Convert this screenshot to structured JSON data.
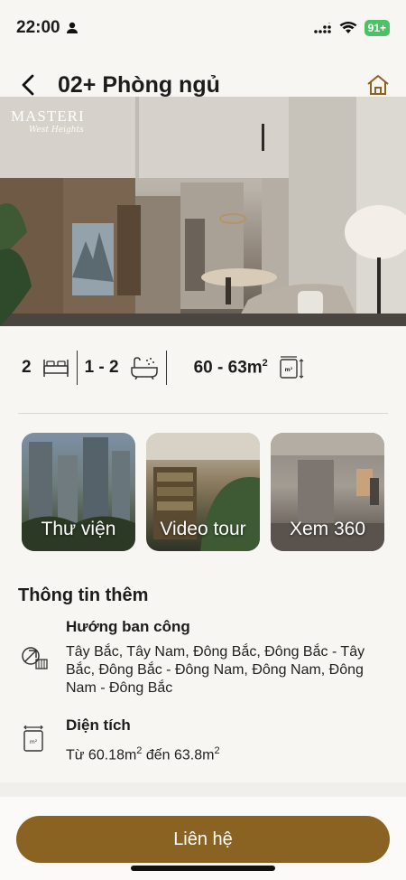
{
  "status": {
    "time": "22:00",
    "battery": "91+"
  },
  "header": {
    "title": "02+ Phòng ngủ"
  },
  "hero": {
    "brand_name": "MASTERI",
    "brand_sub": "West Heights"
  },
  "specs": {
    "bedrooms": "2",
    "bathrooms": "1 - 2",
    "area": "60 - 63m",
    "area_sup": "2"
  },
  "media": [
    {
      "label": "Thư viện",
      "icon": "library"
    },
    {
      "label": "Video tour",
      "icon": "video"
    },
    {
      "label": "Xem 360",
      "icon": "360"
    }
  ],
  "info": {
    "title": "Thông tin thêm",
    "items": [
      {
        "label": "Hướng ban công",
        "value": "Tây Bắc, Tây Nam, Đông Bắc, Đông Bắc - Tây Bắc, Đông Bắc - Đông Nam, Đông Nam, Đông Nam - Đông Bắc",
        "icon": "balcony-direction-icon"
      },
      {
        "label": "Diện tích",
        "value_prefix": "Từ 60.18m",
        "value_mid": " đến 63.8m",
        "sup": "2",
        "icon": "area-icon"
      }
    ]
  },
  "footer": {
    "contact_label": "Liên hệ"
  },
  "colors": {
    "accent": "#8a6322",
    "background": "#f8f6f2"
  }
}
